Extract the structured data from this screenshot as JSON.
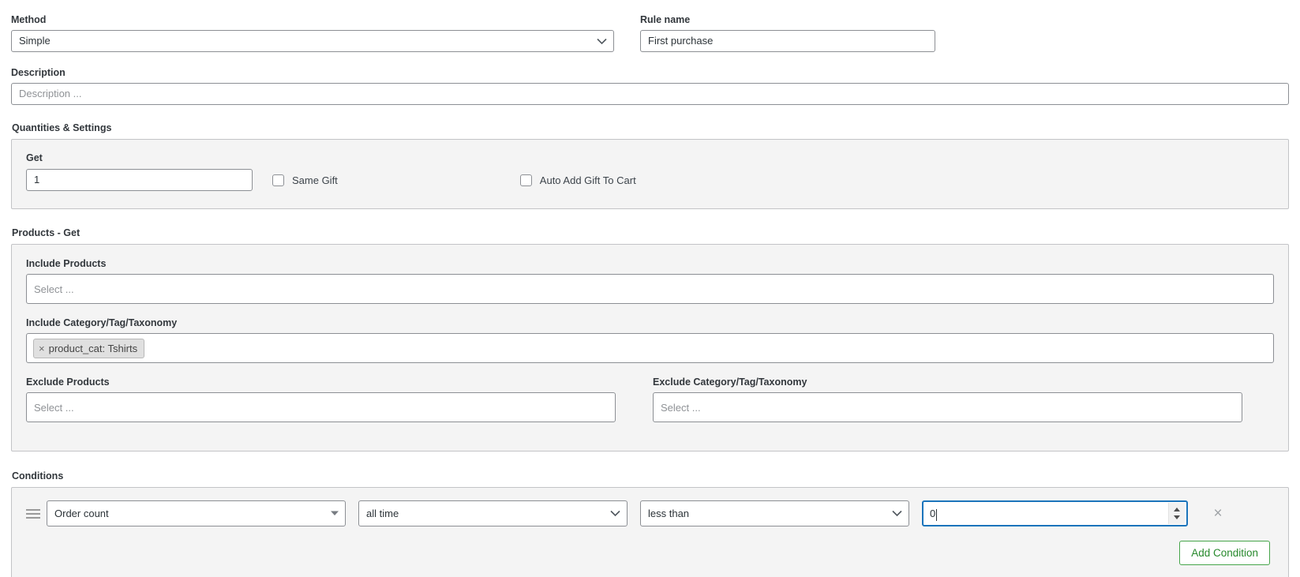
{
  "method": {
    "label": "Method",
    "value": "Simple",
    "icon": "chevron-down-icon"
  },
  "rule_name": {
    "label": "Rule name",
    "value": "First purchase"
  },
  "description": {
    "label": "Description",
    "placeholder": "Description ...",
    "value": ""
  },
  "quantities": {
    "title": "Quantities & Settings",
    "get": {
      "label": "Get",
      "value": "1"
    },
    "same_gift": {
      "label": "Same Gift",
      "checked": false
    },
    "auto_add_gift": {
      "label": "Auto Add Gift To Cart",
      "checked": false
    }
  },
  "products_get": {
    "title": "Products - Get",
    "include_products": {
      "label": "Include Products",
      "placeholder": "Select ..."
    },
    "include_category": {
      "label": "Include Category/Tag/Taxonomy",
      "tags": [
        {
          "remove_icon": "×",
          "text": "product_cat: Tshirts"
        }
      ]
    },
    "exclude_products": {
      "label": "Exclude Products",
      "placeholder": "Select ..."
    },
    "exclude_category": {
      "label": "Exclude Category/Tag/Taxonomy",
      "placeholder": "Select ..."
    }
  },
  "conditions": {
    "title": "Conditions",
    "rows": [
      {
        "drag_icon": "drag-handle-icon",
        "field": "Order count",
        "period": "all time",
        "operator": "less than",
        "amount": "0",
        "remove_icon": "×"
      }
    ],
    "add_button": "Add Condition"
  },
  "colors": {
    "focus_border": "#1b74bb",
    "panel_bg": "#f4f4f4",
    "panel_border": "#c3c4c7",
    "input_border": "#8c8f94",
    "add_button_green": "#27892c",
    "add_button_border": "#46a54a",
    "tag_bg": "#e0e0e0"
  }
}
